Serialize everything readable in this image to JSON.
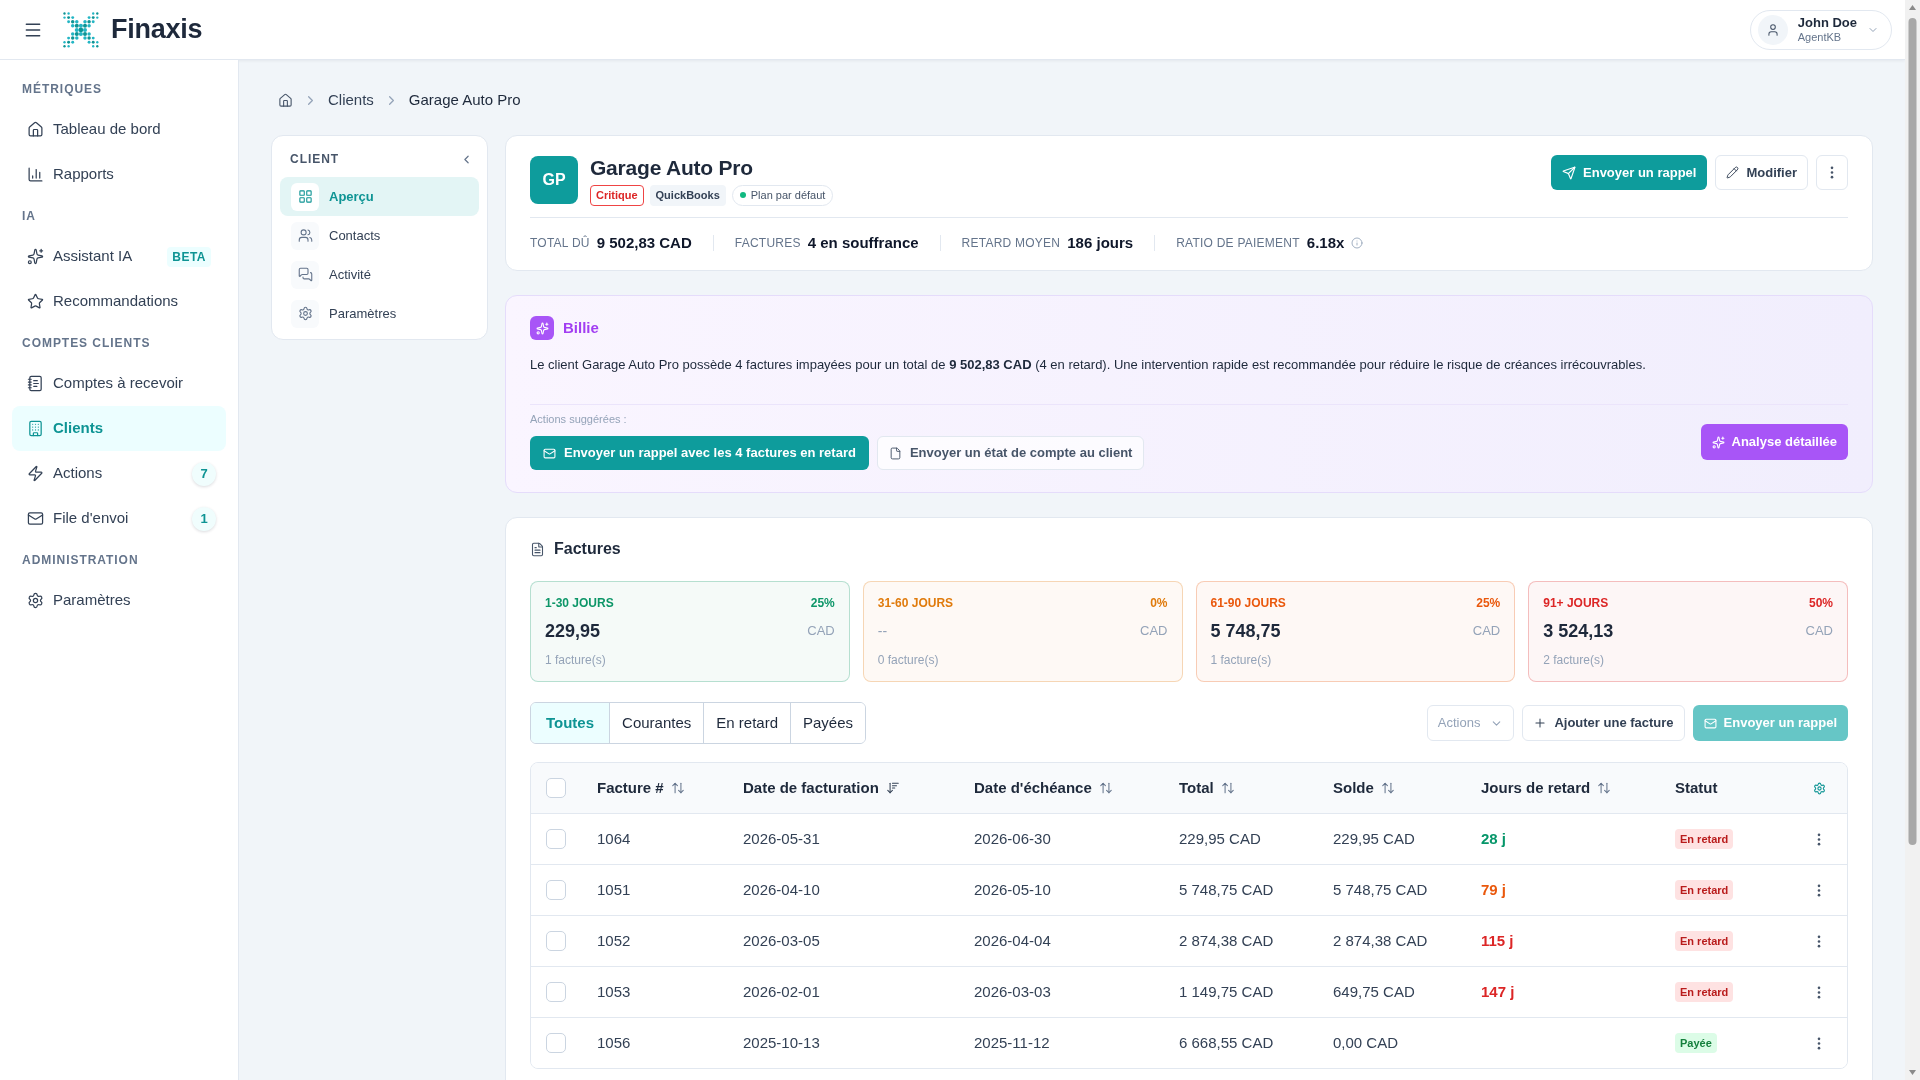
{
  "header": {
    "brand": "Finaxis",
    "user": {
      "name": "John Doe",
      "role": "AgentKB"
    }
  },
  "sidebar": {
    "sections": [
      {
        "title": "MÉTRIQUES",
        "items": [
          {
            "label": "Tableau de bord",
            "selected": false
          },
          {
            "label": "Rapports",
            "selected": false
          }
        ]
      },
      {
        "title": "IA",
        "items": [
          {
            "label": "Assistant IA",
            "selected": false,
            "badge": {
              "text": "BETA",
              "kind": "tag"
            }
          },
          {
            "label": "Recommandations",
            "selected": false
          }
        ]
      },
      {
        "title": "COMPTES CLIENTS",
        "items": [
          {
            "label": "Comptes à recevoir",
            "selected": false
          },
          {
            "label": "Clients",
            "selected": true
          },
          {
            "label": "Actions",
            "selected": false,
            "badge": {
              "text": "7",
              "kind": "count"
            }
          },
          {
            "label": "File d'envoi",
            "selected": false,
            "badge": {
              "text": "1",
              "kind": "count"
            }
          }
        ]
      },
      {
        "title": "ADMINISTRATION",
        "items": [
          {
            "label": "Paramètres",
            "selected": false
          }
        ]
      }
    ]
  },
  "breadcrumb": [
    "Clients",
    "Garage Auto Pro"
  ],
  "client_nav": {
    "title": "CLIENT",
    "items": [
      {
        "label": "Aperçu",
        "selected": true
      },
      {
        "label": "Contacts",
        "selected": false
      },
      {
        "label": "Activité",
        "selected": false
      },
      {
        "label": "Paramètres",
        "selected": false
      }
    ]
  },
  "client": {
    "initials": "GP",
    "name": "Garage Auto Pro",
    "tags": [
      {
        "text": "Critique",
        "kind": "danger"
      },
      {
        "text": "QuickBooks",
        "kind": "neutral"
      },
      {
        "text": "Plan par défaut",
        "kind": "status",
        "color": "#10b981"
      }
    ],
    "actions": [
      {
        "label": "Envoyer un rappel",
        "kind": "send"
      },
      {
        "label": "Modifier",
        "kind": "edit"
      },
      {
        "kind": "more"
      }
    ],
    "stats": [
      {
        "label": "TOTAL DÛ",
        "value": "9 502,83 CAD",
        "info": false
      },
      {
        "label": "FACTURES",
        "value": "4 en souffrance",
        "info": false
      },
      {
        "label": "RETARD MOYEN",
        "value": "186 jours",
        "info": false
      },
      {
        "label": "RATIO DE PAIEMENT",
        "value": "6.18x",
        "info": true
      }
    ]
  },
  "billie": {
    "name": "Billie",
    "message": "Le client Garage Auto Pro possède 4 factures impayées pour un total de **9 502,83 CAD** (4 en retard). Une intervention rapide est recommandée pour réduire le risque de créances irrécouvrables.",
    "suggestions_label": "Actions suggérées :",
    "suggestions": [
      {
        "label": "Envoyer un rappel avec les 4 factures en retard",
        "kind": "email"
      },
      {
        "label": "Envoyer un état de compte au client",
        "kind": "document"
      }
    ],
    "analysis_button": "Analyse détaillée"
  },
  "invoices": {
    "title": "Factures",
    "buckets": [
      {
        "label": "1-30 JOURS",
        "percent": "25%",
        "amount": "229,95",
        "muted": false,
        "currency": "CAD",
        "count": "1 facture(s)",
        "color": "#0d9668"
      },
      {
        "label": "31-60 JOURS",
        "percent": "0%",
        "amount": "--",
        "muted": true,
        "currency": "CAD",
        "count": "0 facture(s)",
        "color": "#e07b0c"
      },
      {
        "label": "61-90 JOURS",
        "percent": "25%",
        "amount": "5 748,75",
        "muted": false,
        "currency": "CAD",
        "count": "1 facture(s)",
        "color": "#ea580c"
      },
      {
        "label": "91+ JOURS",
        "percent": "50%",
        "amount": "3 524,13",
        "muted": false,
        "currency": "CAD",
        "count": "2 facture(s)",
        "color": "#dc2626"
      }
    ],
    "tabs": [
      {
        "label": "Toutes",
        "selected": true
      },
      {
        "label": "Courantes",
        "selected": false
      },
      {
        "label": "En retard",
        "selected": false
      },
      {
        "label": "Payées",
        "selected": false
      }
    ],
    "toolbar": [
      {
        "label": "Actions",
        "kind": "dropdown",
        "disabled": true
      },
      {
        "label": "Ajouter une facture",
        "kind": "add",
        "disabled": false
      },
      {
        "label": "Envoyer un rappel",
        "kind": "send",
        "disabled": true
      }
    ],
    "table": {
      "select_all_checked": false,
      "columns": [
        {
          "label": "Facture #",
          "sortable": true,
          "sorted": false
        },
        {
          "label": "Date de facturation",
          "sortable": true,
          "sorted": true
        },
        {
          "label": "Date d'échéance",
          "sortable": true,
          "sorted": false
        },
        {
          "label": "Total",
          "sortable": true,
          "sorted": false
        },
        {
          "label": "Solde",
          "sortable": true,
          "sorted": false
        },
        {
          "label": "Jours de retard",
          "sortable": true,
          "sorted": false
        },
        {
          "label": "Statut",
          "sortable": false
        }
      ],
      "rows": [
        {
          "checked": false,
          "number": "1064",
          "invoice_date": "2026-05-31",
          "due_date": "2026-06-30",
          "total": "229,95 CAD",
          "balance": "229,95 CAD",
          "days": {
            "text": "28 j",
            "color": "#059669"
          },
          "status": {
            "label": "En retard",
            "kind": "overdue"
          }
        },
        {
          "checked": false,
          "number": "1051",
          "invoice_date": "2026-04-10",
          "due_date": "2026-05-10",
          "total": "5 748,75 CAD",
          "balance": "5 748,75 CAD",
          "days": {
            "text": "79 j",
            "color": "#ea580c"
          },
          "status": {
            "label": "En retard",
            "kind": "overdue"
          }
        },
        {
          "checked": false,
          "number": "1052",
          "invoice_date": "2026-03-05",
          "due_date": "2026-04-04",
          "total": "2 874,38 CAD",
          "balance": "2 874,38 CAD",
          "days": {
            "text": "115 j",
            "color": "#dc2626"
          },
          "status": {
            "label": "En retard",
            "kind": "overdue"
          }
        },
        {
          "checked": false,
          "number": "1053",
          "invoice_date": "2026-02-01",
          "due_date": "2026-03-03",
          "total": "1 149,75 CAD",
          "balance": "649,75 CAD",
          "days": {
            "text": "147 j",
            "color": "#dc2626"
          },
          "status": {
            "label": "En retard",
            "kind": "overdue"
          }
        },
        {
          "checked": false,
          "number": "1056",
          "invoice_date": "2025-10-13",
          "due_date": "2025-11-12",
          "total": "6 668,55 CAD",
          "balance": "0,00 CAD",
          "status": {
            "label": "Payée",
            "kind": "paid"
          }
        }
      ]
    }
  }
}
